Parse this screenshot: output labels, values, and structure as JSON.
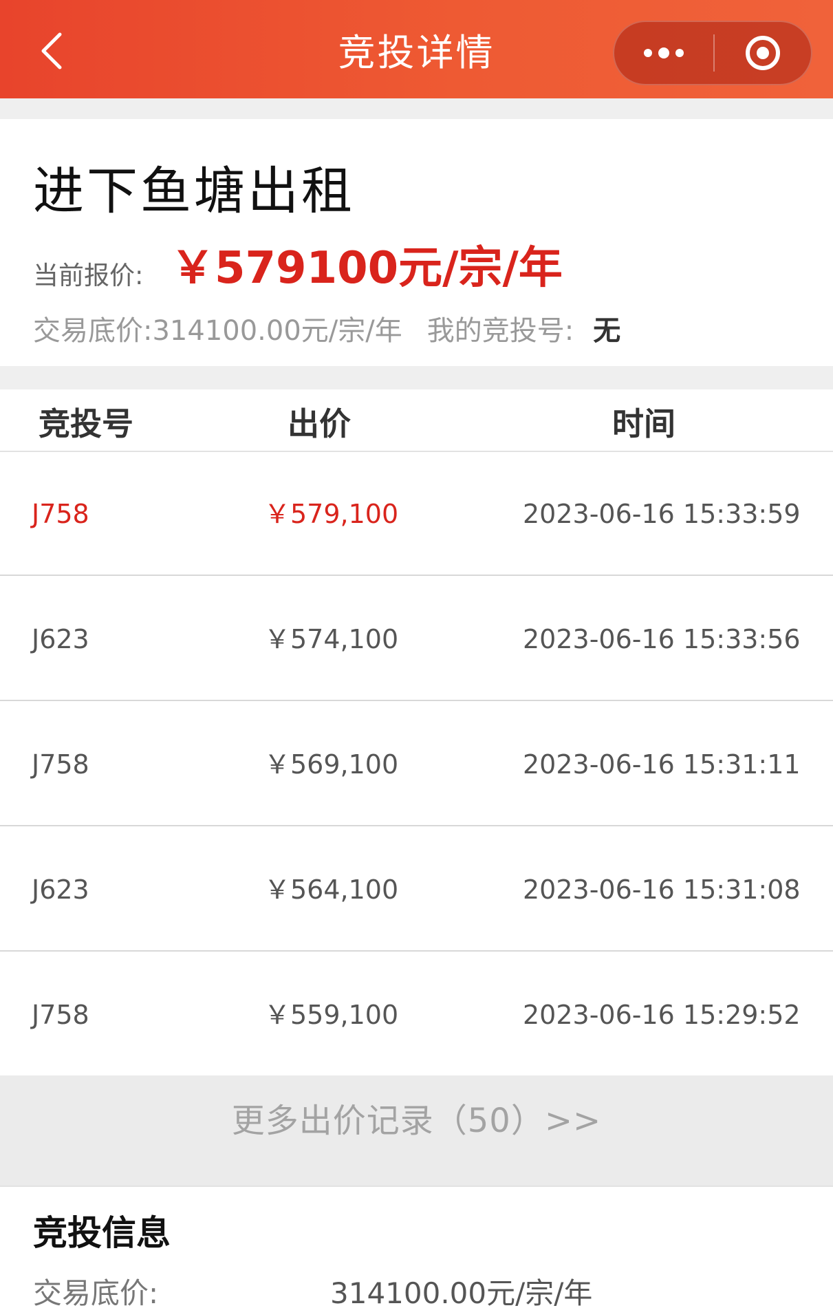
{
  "header": {
    "title": "竞投详情"
  },
  "summary": {
    "title": "进下鱼塘出租",
    "current_label": "当前报价:",
    "current_price": "￥579100元/宗/年",
    "base_label": "交易底价:",
    "base_value": "314100.00元/宗/年",
    "mine_label": "我的竞投号:",
    "mine_value": "无"
  },
  "table": {
    "headers": [
      "竞投号",
      "出价",
      "时间"
    ],
    "rows": [
      {
        "code": "J758",
        "price": "￥579,100",
        "time": "2023-06-16 15:33:59"
      },
      {
        "code": "J623",
        "price": "￥574,100",
        "time": "2023-06-16 15:33:56"
      },
      {
        "code": "J758",
        "price": "￥569,100",
        "time": "2023-06-16 15:31:11"
      },
      {
        "code": "J623",
        "price": "￥564,100",
        "time": "2023-06-16 15:31:08"
      },
      {
        "code": "J758",
        "price": "￥559,100",
        "time": "2023-06-16 15:29:52"
      }
    ],
    "more_label": "更多出价记录（50）>>"
  },
  "info": {
    "title": "竞投信息",
    "base_label": "交易底价:",
    "base_value": "314100.00元/宗/年"
  },
  "colors": {
    "accent": "#e8442c",
    "price_red": "#d9241c"
  },
  "icons": {
    "back": "chevron-left-icon",
    "more": "more-dots-icon",
    "close": "target-circle-icon"
  }
}
